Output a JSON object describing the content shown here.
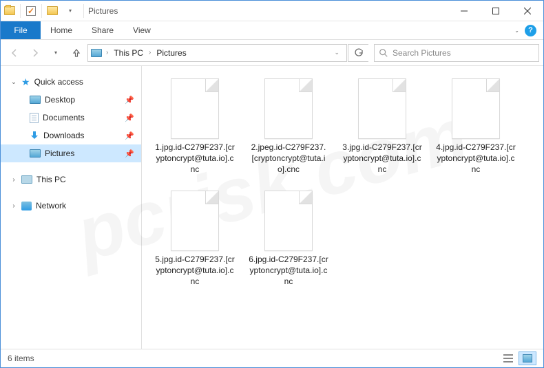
{
  "title": "Pictures",
  "ribbon": {
    "file": "File",
    "tabs": [
      "Home",
      "Share",
      "View"
    ]
  },
  "breadcrumb": [
    "This PC",
    "Pictures"
  ],
  "search": {
    "placeholder": "Search Pictures"
  },
  "sidebar": {
    "quick_access": "Quick access",
    "items": [
      {
        "label": "Desktop"
      },
      {
        "label": "Documents"
      },
      {
        "label": "Downloads"
      },
      {
        "label": "Pictures"
      }
    ],
    "this_pc": "This PC",
    "network": "Network"
  },
  "files": [
    {
      "name": "1.jpg.id-C279F237.[cryptoncrypt@tuta.io].cnc"
    },
    {
      "name": "2.jpeg.id-C279F237.[cryptoncrypt@tuta.io].cnc"
    },
    {
      "name": "3.jpg.id-C279F237.[cryptoncrypt@tuta.io].cnc"
    },
    {
      "name": "4.jpg.id-C279F237.[cryptoncrypt@tuta.io].cnc"
    },
    {
      "name": "5.jpg.id-C279F237.[cryptoncrypt@tuta.io].cnc"
    },
    {
      "name": "6.jpg.id-C279F237.[cryptoncrypt@tuta.io].cnc"
    }
  ],
  "status": {
    "count": "6 items"
  }
}
